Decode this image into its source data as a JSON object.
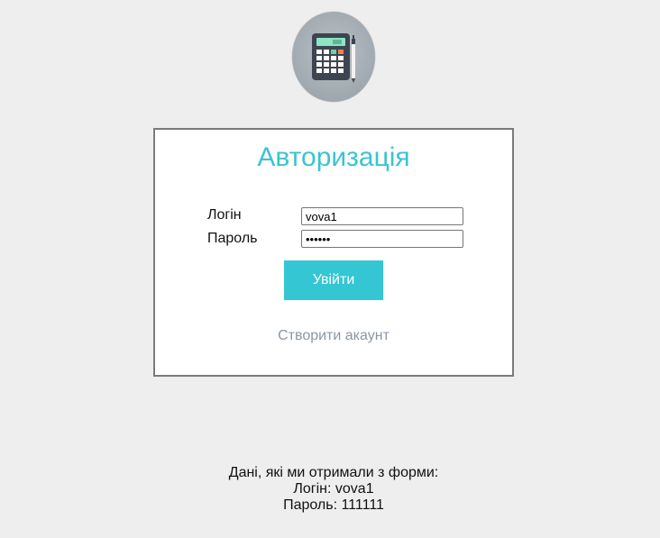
{
  "form": {
    "title": "Авторизація",
    "login_label": "Логін",
    "login_value": "vova1",
    "password_label": "Пароль",
    "password_value": "111111",
    "submit_label": "Увійти",
    "create_account_label": "Створити акаунт"
  },
  "result": {
    "heading": "Дані, які ми отримали з форми:",
    "login_line": "Логін: vova1",
    "password_line": "Пароль: 111111"
  },
  "logo": {
    "icon": "calculator-icon"
  },
  "colors": {
    "accent": "#34c6d3",
    "title": "#3cc3d2",
    "link": "#8a97a3",
    "background": "#eeeeee"
  }
}
